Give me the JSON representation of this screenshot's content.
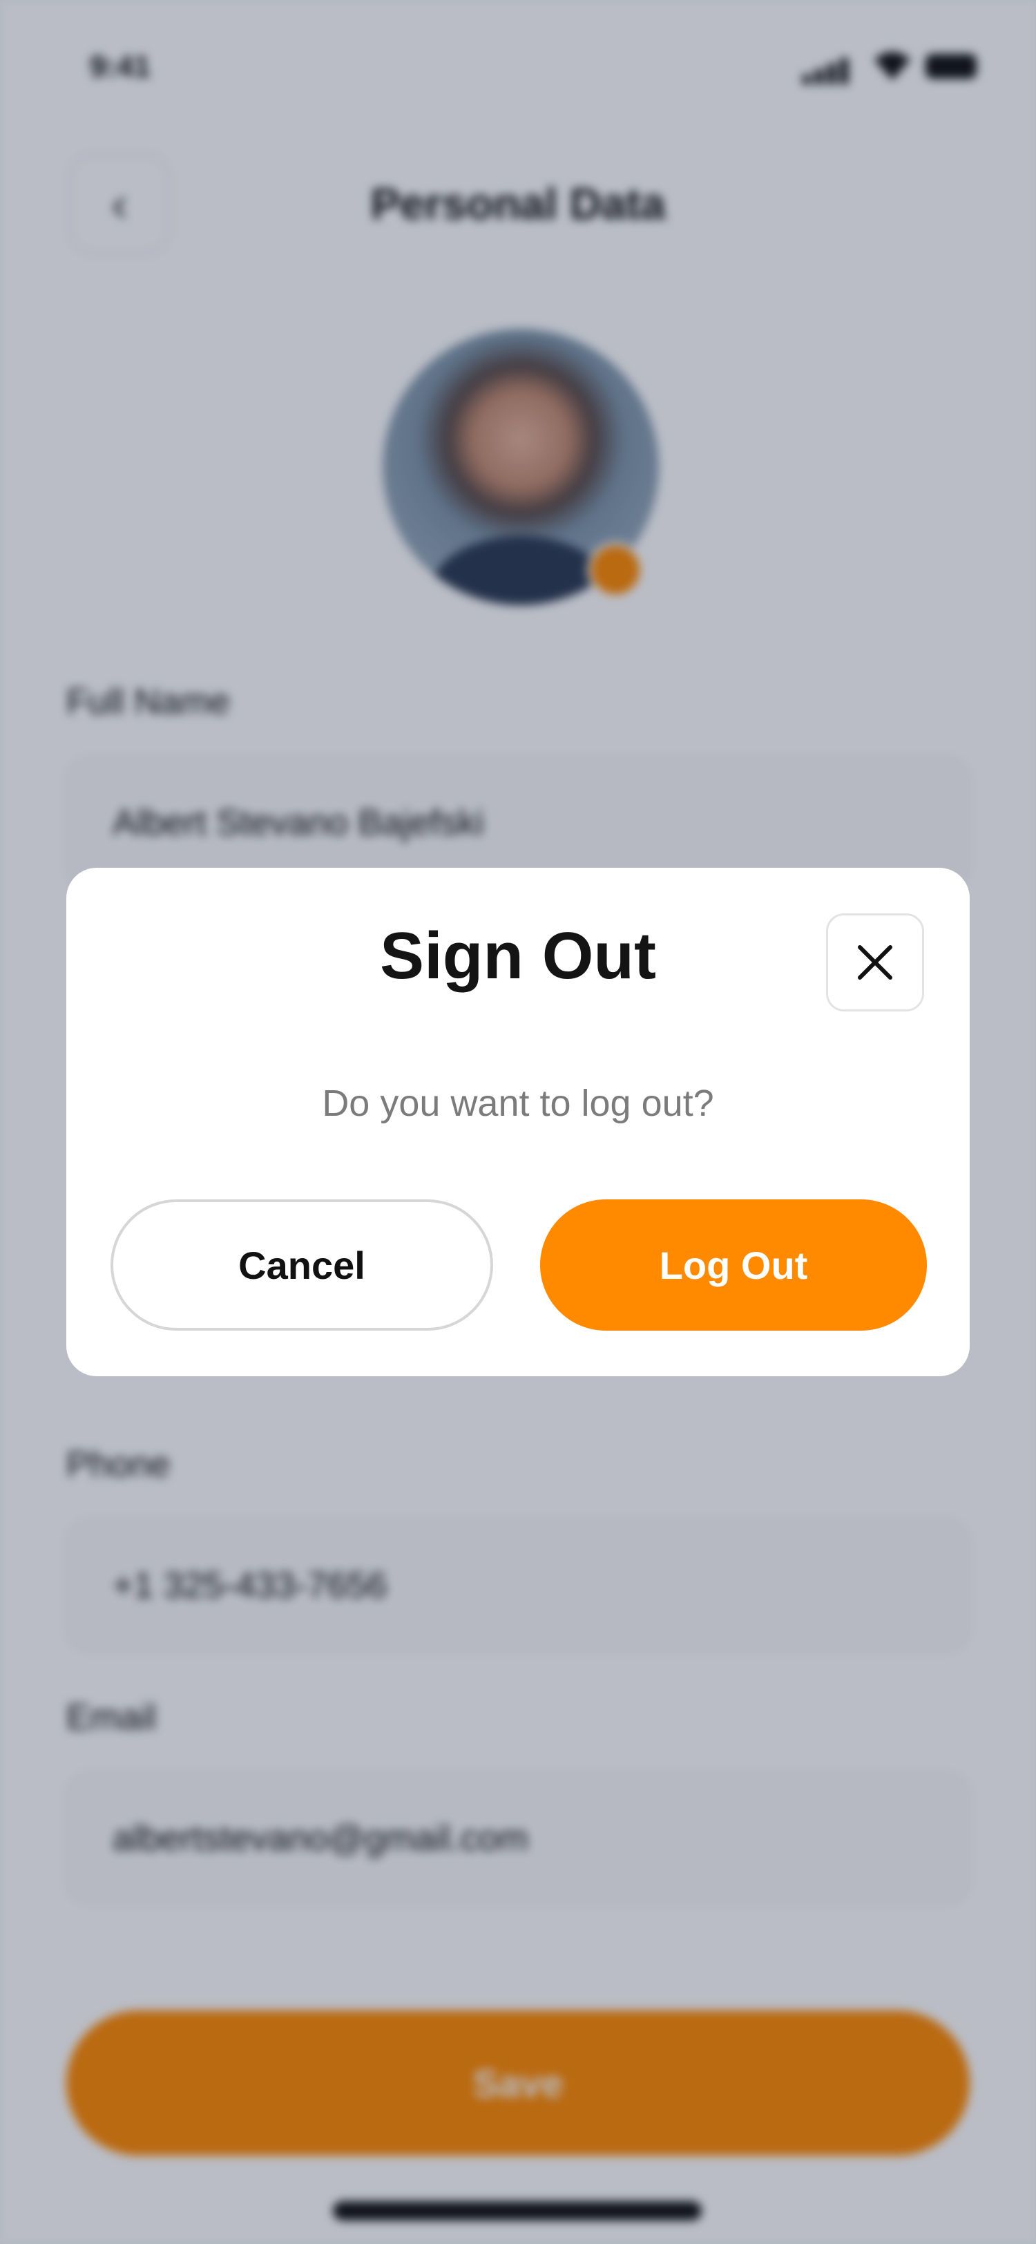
{
  "status_bar": {
    "time": "9:41",
    "icons": [
      "signal-icon",
      "wifi-icon",
      "battery-icon"
    ]
  },
  "header": {
    "title": "Personal Data",
    "back_icon": "chevron-left-icon"
  },
  "profile": {
    "avatar": "avatar",
    "edit_badge_color": "#ff8a00"
  },
  "form": {
    "fields": [
      {
        "label": "Full Name",
        "value": "Albert Stevano Bajefski"
      },
      {
        "label": "Phone",
        "value": "+1 325-433-7656"
      },
      {
        "label": "Email",
        "value": "albertstevano@gmail.com"
      }
    ],
    "save_label": "Save"
  },
  "modal": {
    "title": "Sign Out",
    "close_icon": "close-icon",
    "message": "Do you want to log out?",
    "cancel_label": "Cancel",
    "confirm_label": "Log Out"
  },
  "colors": {
    "accent": "#ff8a00",
    "overlay": "#101c3a"
  }
}
